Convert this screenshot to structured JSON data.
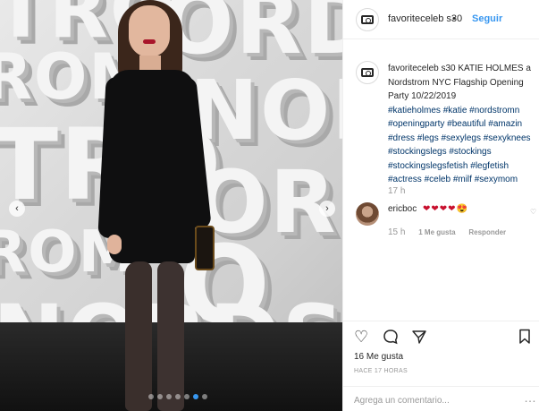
{
  "post": {
    "username": "favoriteceleb s30",
    "follow_label": "Seguir",
    "separator": "•",
    "caption": {
      "username": "favoriteceleb s30",
      "text_line1": "KATIE HOLMES a",
      "text_line2": "Nordstrom NYC Flagship Opening",
      "text_line3": "Party 10/22/2019",
      "hashtag_lines": [
        "#katieholmes #katie #nordstromn",
        "#openingparty #beautiful #amazin",
        "#dress #legs #sexylegs #sexyknees",
        "#stockingslegs #stockings",
        "#stockingslegsfetish #legfetish",
        "#actress #celeb #milf #sexymom"
      ],
      "time": "17 h"
    },
    "comment": {
      "username": "ericboc",
      "emojis": "❤❤❤❤",
      "emoji_last": "😍",
      "time": "15 h",
      "likes": "1 Me gusta",
      "reply": "Responder"
    },
    "likes": "16 Me gusta",
    "posted": "HACE 17 HORAS",
    "add_comment_placeholder": "Agrega un comentario...",
    "more": "…"
  },
  "photo": {
    "wall_words": [
      "TRO",
      "ORD",
      "ROM",
      "NORD",
      "TRO",
      "ORDS",
      "ROM",
      "O",
      "NORDS"
    ]
  },
  "carousel": {
    "prev": "‹",
    "next": "›",
    "dot_count": 7,
    "active_index": 5
  },
  "icons": {
    "like": "heart-outline-icon",
    "comment": "comment-bubble-icon",
    "share": "paper-plane-icon",
    "save": "bookmark-icon",
    "avatar": "camera-icon",
    "comment_like": "small-heart-icon"
  },
  "colors": {
    "link": "#3897f0",
    "hashtag": "#003569",
    "muted": "#999999",
    "text": "#262626"
  }
}
